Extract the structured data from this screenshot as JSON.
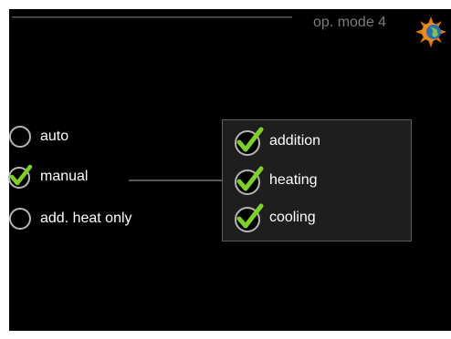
{
  "header": {
    "title": "op. mode 4",
    "mode_icon": "sun-globe-icon"
  },
  "modes": [
    {
      "label": "auto",
      "selected": false
    },
    {
      "label": "manual",
      "selected": true
    },
    {
      "label": "add. heat only",
      "selected": false
    }
  ],
  "manual_options": [
    {
      "label": "addition",
      "checked": true
    },
    {
      "label": "heating",
      "checked": true
    },
    {
      "label": "cooling",
      "checked": true
    }
  ],
  "colors": {
    "background": "#000000",
    "text": "#ffffff",
    "title": "#7a7a7a",
    "check": "#7dcf2a",
    "popup_bg": "#1e1e1e"
  }
}
